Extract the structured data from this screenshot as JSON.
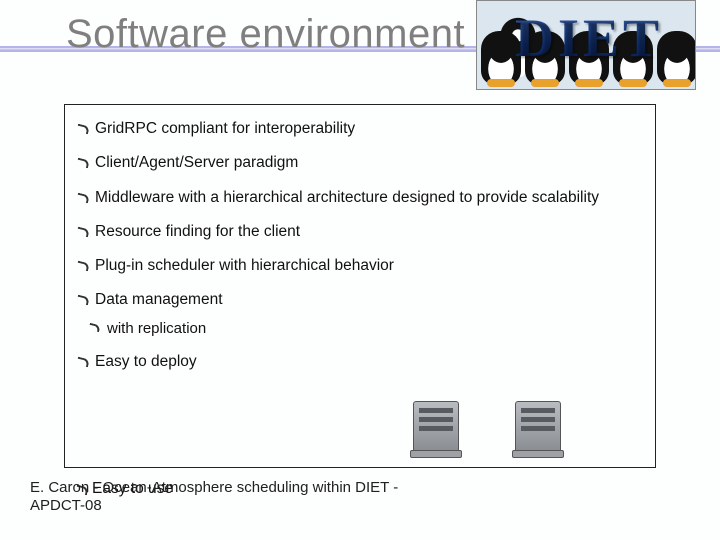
{
  "title": "Software environment",
  "logo_text": "DIET",
  "bullets": [
    "GridRPC compliant for interoperability",
    "Client/Agent/Server paradigm",
    "Middleware with a hierarchical architecture designed to provide scalability",
    "Resource finding for the client",
    "Plug-in scheduler with hierarchical behavior",
    "Data management"
  ],
  "sub_bullets": [
    "with replication"
  ],
  "bullets_tail": [
    "Easy to deploy"
  ],
  "overlay_bullet": "Easy to use",
  "footer_line1": "E. Caron - Ocean-Atmosphere scheduling within DIET -",
  "footer_line2": "APDCT-08"
}
